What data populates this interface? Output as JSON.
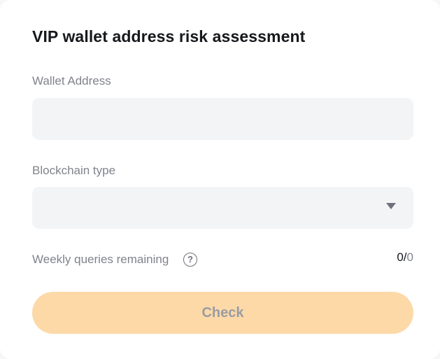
{
  "card": {
    "title": "VIP wallet address risk assessment"
  },
  "wallet_address": {
    "label": "Wallet Address",
    "value": "",
    "placeholder": ""
  },
  "blockchain_type": {
    "label": "Blockchain type",
    "selected": "",
    "icon": "caret-down-icon"
  },
  "queries": {
    "label": "Weekly queries remaining",
    "help_icon": "question-circle-icon",
    "help_glyph": "?",
    "used": "0",
    "separator": "/",
    "total": "0"
  },
  "check_button": {
    "label": "Check",
    "state": "disabled"
  },
  "colors": {
    "button_bg": "#fdd9a8",
    "field_bg": "#f3f4f6",
    "label_text": "#80838b",
    "title_text": "#16181c"
  }
}
